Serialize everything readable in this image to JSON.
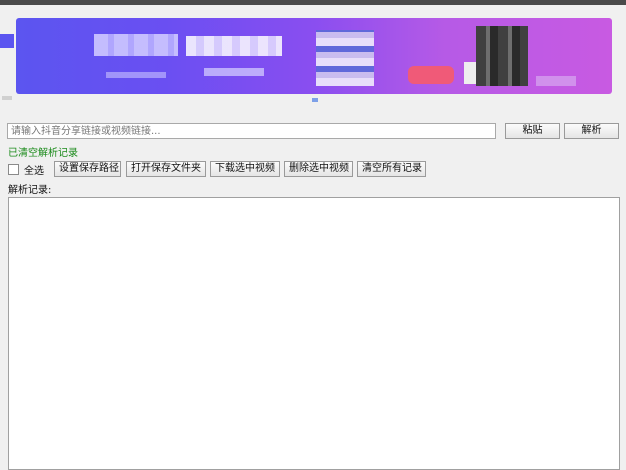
{
  "input": {
    "placeholder": "请输入抖音分享链接或视频链接..."
  },
  "buttons": {
    "paste": "粘贴",
    "parse": "解析",
    "set_save_path": "设置保存路径",
    "open_save_folder": "打开保存文件夹",
    "download_selected": "下载选中视频",
    "delete_selected": "删除选中视频",
    "clear_all": "清空所有记录"
  },
  "status": {
    "message": "已清空解析记录",
    "color": "#1a8a1a"
  },
  "select_all": {
    "label": "全选",
    "checked": false
  },
  "log": {
    "label": "解析记录:"
  }
}
